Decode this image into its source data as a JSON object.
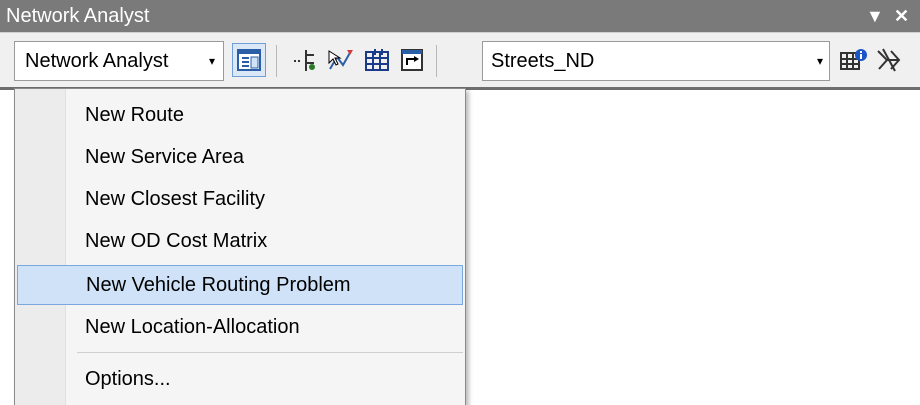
{
  "window": {
    "title": "Network Analyst",
    "dropdown_glyph": "▼",
    "close_glyph": "✕"
  },
  "toolbar": {
    "menu_button_label": "Network Analyst",
    "caret": "▾",
    "network_dataset": "Streets_ND",
    "tools": [
      {
        "name": "network-analyst-window-icon",
        "active": true
      },
      {
        "name": "create-network-location-icon"
      },
      {
        "name": "select-move-location-icon"
      },
      {
        "name": "solve-grid-icon"
      },
      {
        "name": "directions-window-icon"
      },
      {
        "name": "build-network-icon"
      },
      {
        "name": "network-identify-icon"
      }
    ]
  },
  "menu": {
    "items": [
      {
        "label": "New Route"
      },
      {
        "label": "New Service Area"
      },
      {
        "label": "New Closest Facility"
      },
      {
        "label": "New OD Cost Matrix"
      },
      {
        "label": "New Vehicle Routing Problem",
        "highlighted": true
      },
      {
        "label": "New Location-Allocation"
      },
      {
        "label": "Options..."
      }
    ]
  },
  "colors": {
    "highlight": "#cfe2f7",
    "highlight_border": "#7aa7dc",
    "titlebar": "#7a7a7a"
  }
}
